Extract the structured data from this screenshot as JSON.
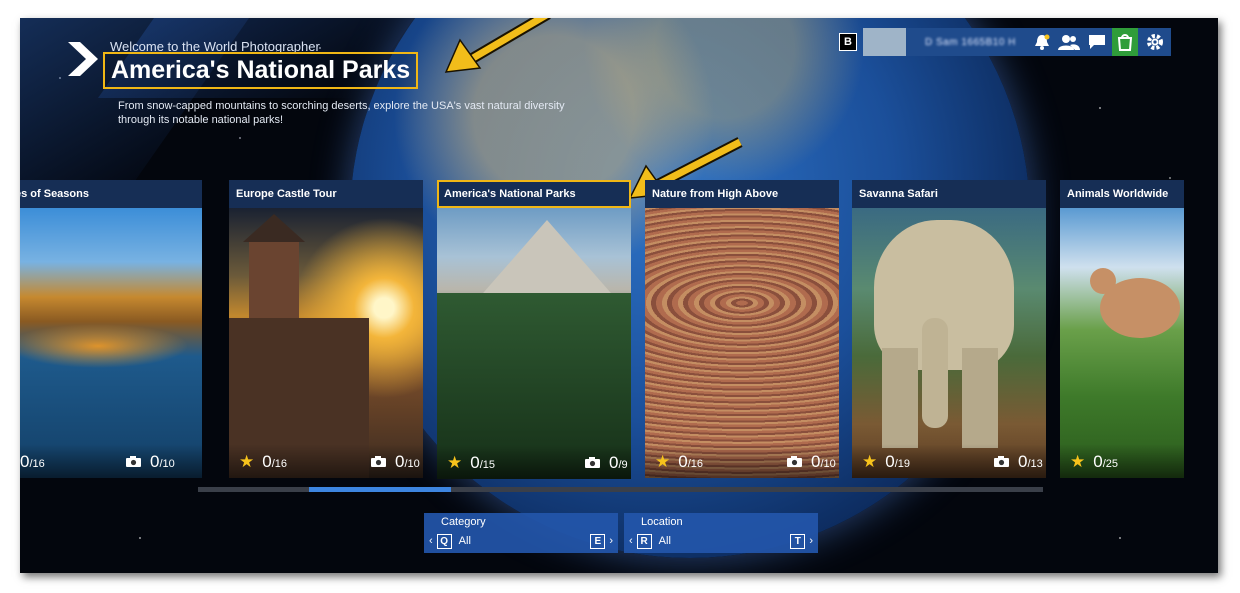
{
  "header": {
    "welcome": "Welcome to the World Photographer",
    "title": "America's National Parks",
    "description": "From snow-capped mountains to scorching deserts, explore the USA's vast natural diversity through its notable national parks!"
  },
  "topbar": {
    "b_key": "B",
    "profile_name": "D Sam 1665B10 H",
    "icons": [
      "notification-bell-icon",
      "friends-icon",
      "chat-icon",
      "shop-icon",
      "settings-gear-icon"
    ]
  },
  "cards": [
    {
      "title": "es of Seasons",
      "stars": null,
      "photos": "0",
      "photos_total": "/16",
      "photos2": "0",
      "photos2_total": "/10"
    },
    {
      "title": "Europe Castle Tour",
      "stars": "0",
      "stars_total": "/16",
      "photos": "0",
      "photos_total": "/10"
    },
    {
      "title": "America's National Parks",
      "stars": "0",
      "stars_total": "/15",
      "photos": "0",
      "photos_total": "/9"
    },
    {
      "title": "Nature from High Above",
      "stars": "0",
      "stars_total": "/16",
      "photos": "0",
      "photos_total": "/10"
    },
    {
      "title": "Savanna Safari",
      "stars": "0",
      "stars_total": "/19",
      "photos": "0",
      "photos_total": "/13"
    },
    {
      "title": "Animals Worldwide",
      "stars": "0",
      "stars_total": "/25"
    }
  ],
  "filters": {
    "category": {
      "label": "Category",
      "left_key": "Q",
      "value": "All",
      "right_key": "E"
    },
    "location": {
      "label": "Location",
      "left_key": "R",
      "value": "All",
      "right_key": "T"
    }
  },
  "colors": {
    "accent": "#f0b715",
    "panel_blue": "#2356aa",
    "scroll_thumb": "#3d85e0"
  }
}
